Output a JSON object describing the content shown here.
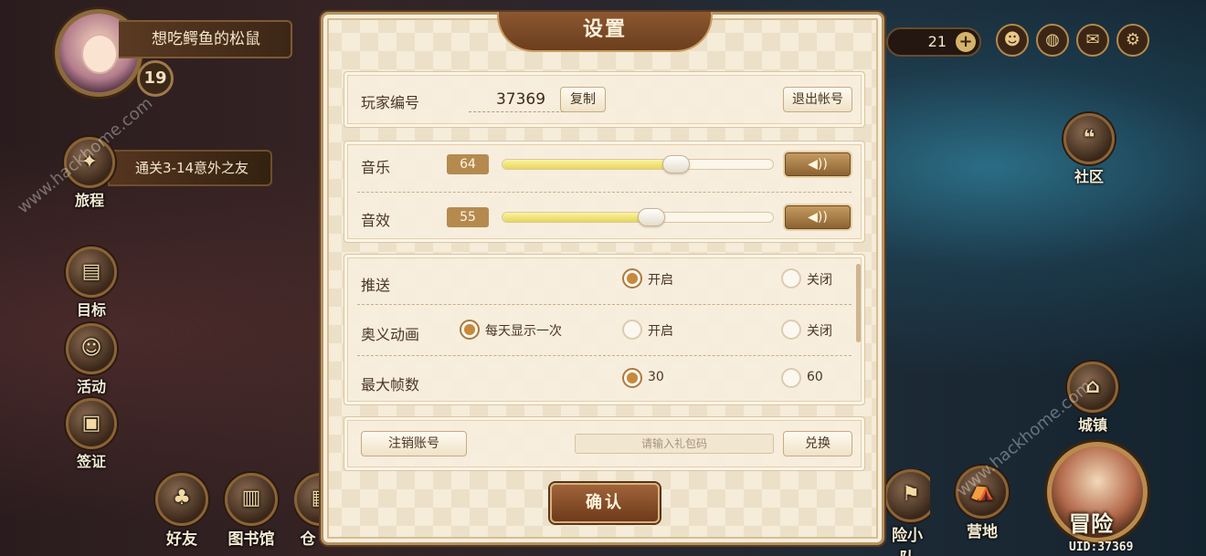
{
  "hud": {
    "player_name": "想吃鳄鱼的松鼠",
    "level": "19",
    "quest": "通关3-14意外之友",
    "currency_amount": "21",
    "left_menu": [
      "旅程",
      "目标",
      "活动",
      "签证"
    ],
    "bottom_menu": [
      "好友",
      "图书馆",
      "仓"
    ],
    "right_menu": [
      "社区",
      "城镇",
      "险小队",
      "营地"
    ],
    "adventure": "冒险",
    "uid": "UID:37369"
  },
  "dialog": {
    "title": "设置",
    "account": {
      "label": "玩家编号",
      "player_id": "37369",
      "copy_button": "复制",
      "logout_button": "退出帐号"
    },
    "volume": {
      "music_label": "音乐",
      "music_value": "64",
      "music_level": 0.64,
      "sfx_label": "音效",
      "sfx_value": "55",
      "sfx_level": 0.55,
      "speaker_glyph": "◀))"
    },
    "options": {
      "push_label": "推送",
      "push_on": "开启",
      "push_off": "关闭",
      "anim_label": "奥义动画",
      "anim_daily": "每天显示一次",
      "anim_on": "开启",
      "anim_off": "关闭",
      "fps_label": "最大帧数",
      "fps_30": "30",
      "fps_60": "60"
    },
    "gift": {
      "cancel_account_button": "注销账号",
      "code_placeholder": "请输入礼包码",
      "redeem_button": "兑换"
    },
    "confirm_button": "确认"
  },
  "watermarks": [
    "www.hackhome.com",
    "www.hackhome.com"
  ],
  "colors": {
    "dialog_bg": "#f5ecd9",
    "accent_brown": "#8c5730",
    "slider_fill": "#e7d65a"
  }
}
